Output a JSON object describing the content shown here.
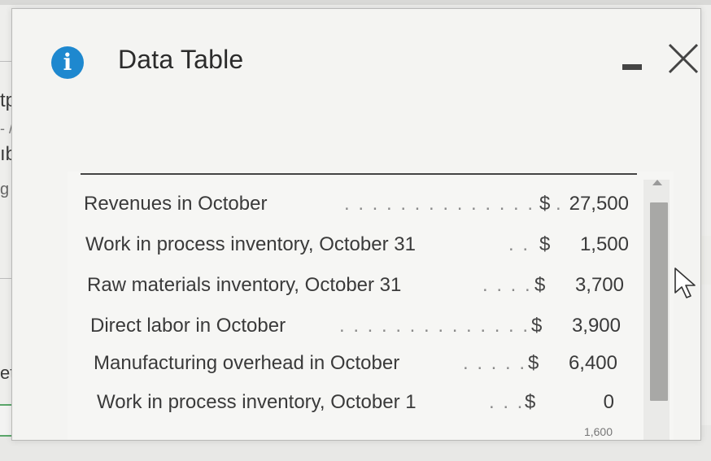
{
  "background": {
    "fragments": [
      "tp",
      "- /",
      "ıbl",
      "g p",
      "eting"
    ]
  },
  "dialog": {
    "title": "Data Table",
    "info_icon": "info-icon",
    "minimize_label": "-",
    "close_label": "X"
  },
  "table": {
    "rows": [
      {
        "label": "Revenues in October",
        "dots": ". . . . . . . . . . . . . . . .",
        "currency": "$",
        "value": "27,500"
      },
      {
        "label": "Work in process inventory, October 31",
        "dots": ". .",
        "currency": "$",
        "value": "1,500"
      },
      {
        "label": "Raw materials inventory, October 31",
        "dots": ". . . .",
        "currency": "$",
        "value": "3,700"
      },
      {
        "label": "Direct labor in October",
        "dots": ". . . . . . . . . . . . . . .",
        "currency": "$",
        "value": "3,900"
      },
      {
        "label": "Manufacturing overhead in October",
        "dots": ". . . . .",
        "currency": "$",
        "value": "6,400"
      },
      {
        "label": "Work in process inventory, October 1",
        "dots": ". . .",
        "currency": "$",
        "value": "0"
      }
    ],
    "partial_value": "1,600"
  },
  "colors": {
    "info_blue": "#1e88cf",
    "dialog_bg": "#f4f4f2",
    "scroll_thumb": "#a8a8a6"
  }
}
